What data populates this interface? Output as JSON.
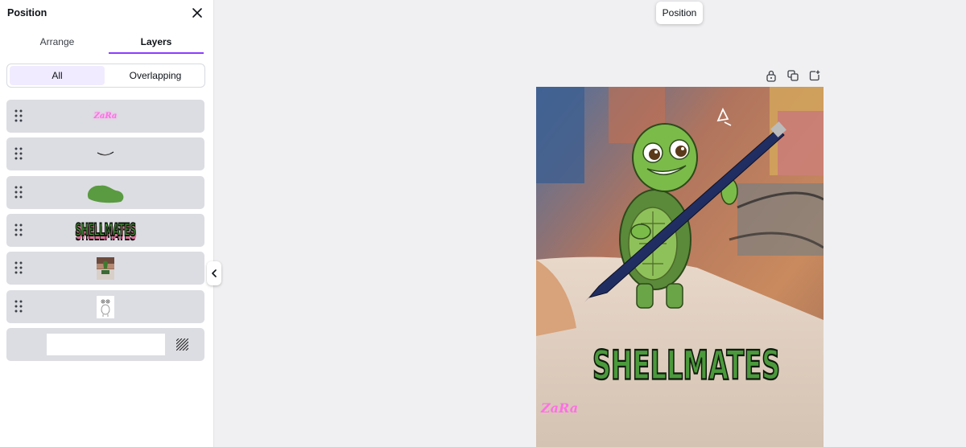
{
  "panel": {
    "title": "Position",
    "tabs": [
      {
        "label": "Arrange",
        "active": false
      },
      {
        "label": "Layers",
        "active": true
      }
    ],
    "filters": [
      {
        "label": "All",
        "active": true
      },
      {
        "label": "Overlapping",
        "active": false
      }
    ],
    "layers": [
      {
        "kind": "text",
        "label": "ZaRa"
      },
      {
        "kind": "shape",
        "name": "smile-line"
      },
      {
        "kind": "shape",
        "name": "green-blob"
      },
      {
        "kind": "text",
        "label": "SHELLMATES"
      },
      {
        "kind": "image",
        "name": "photo"
      },
      {
        "kind": "image",
        "name": "sketch"
      },
      {
        "kind": "background",
        "name": "white-background"
      }
    ]
  },
  "canvas": {
    "position_button": "Position",
    "toolbar_icons": [
      "lock-icon",
      "duplicate-icon",
      "add-page-icon"
    ],
    "design": {
      "headline": "SHELLMATES",
      "signature": "ZaRa"
    }
  },
  "colors": {
    "accent": "#8b3dff",
    "layer_bg": "#dcdde2",
    "headline_fill": "#4b9a3c",
    "headline_shadow": "#f07aa6",
    "signature": "#ff6fe6"
  }
}
